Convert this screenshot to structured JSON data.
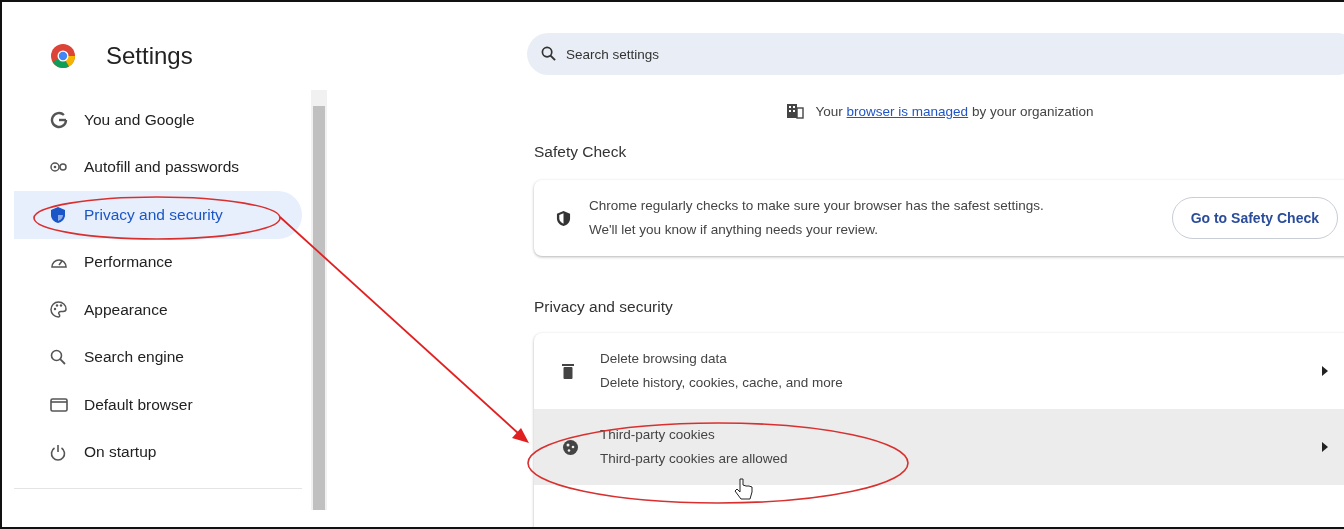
{
  "header": {
    "title": "Settings"
  },
  "sidebar": {
    "items": [
      {
        "label": "You and Google",
        "selected": false
      },
      {
        "label": "Autofill and passwords",
        "selected": false
      },
      {
        "label": "Privacy and security",
        "selected": true
      },
      {
        "label": "Performance",
        "selected": false
      },
      {
        "label": "Appearance",
        "selected": false
      },
      {
        "label": "Search engine",
        "selected": false
      },
      {
        "label": "Default browser",
        "selected": false
      },
      {
        "label": "On startup",
        "selected": false
      }
    ]
  },
  "search": {
    "placeholder": "Search settings"
  },
  "managed_notice": {
    "before": "Your",
    "link": "browser is managed",
    "after": "by your organization"
  },
  "safety_check": {
    "heading": "Safety Check",
    "text": "Chrome regularly checks to make sure your browser has the safest settings.",
    "subtext": "We'll let you know if anything needs your review.",
    "button": "Go to Safety Check"
  },
  "privacy": {
    "heading": "Privacy and security",
    "rows": [
      {
        "title": "Delete browsing data",
        "subtitle": "Delete history, cookies, cache, and more",
        "highlighted": false
      },
      {
        "title": "Third-party cookies",
        "subtitle": "Third-party cookies are allowed",
        "highlighted": true
      }
    ]
  }
}
